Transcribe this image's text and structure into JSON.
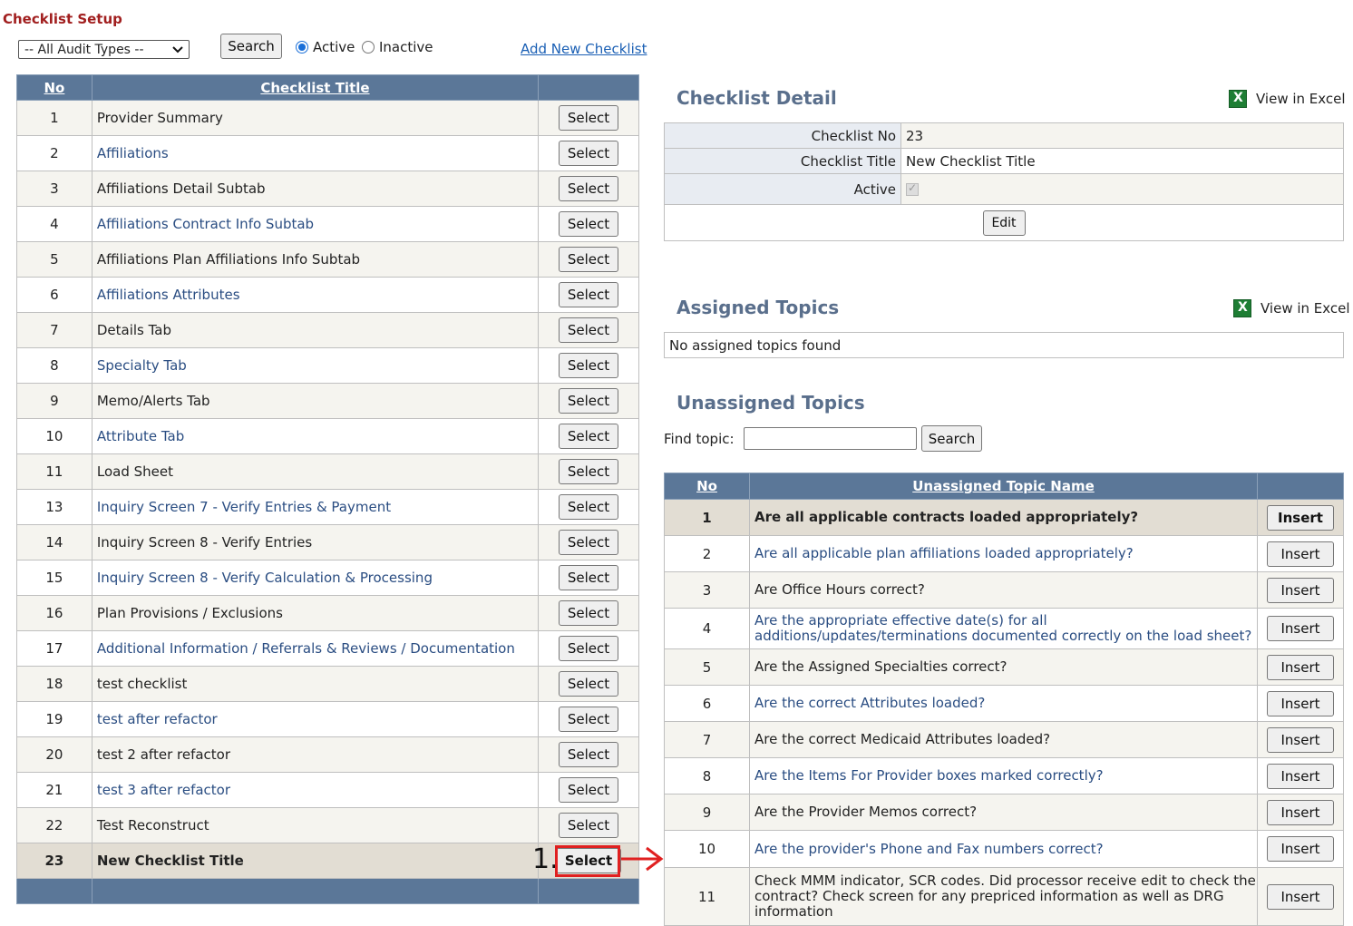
{
  "page": {
    "title": "Checklist Setup"
  },
  "filter": {
    "audit_type": "-- All Audit Types --",
    "search_label": "Search",
    "status_options": [
      {
        "label": "Active",
        "checked": true
      },
      {
        "label": "Inactive",
        "checked": false
      }
    ],
    "add_link": "Add New Checklist"
  },
  "checklist_table": {
    "headers": {
      "no": "No",
      "title": "Checklist Title"
    },
    "select_label": "Select",
    "rows": [
      {
        "no": "1",
        "title": "Provider Summary",
        "link": false
      },
      {
        "no": "2",
        "title": "Affiliations",
        "link": true
      },
      {
        "no": "3",
        "title": "Affiliations Detail Subtab",
        "link": false
      },
      {
        "no": "4",
        "title": "Affiliations Contract Info Subtab",
        "link": true
      },
      {
        "no": "5",
        "title": "Affiliations Plan Affiliations Info Subtab",
        "link": false
      },
      {
        "no": "6",
        "title": "Affiliations Attributes",
        "link": true
      },
      {
        "no": "7",
        "title": "Details Tab",
        "link": false
      },
      {
        "no": "8",
        "title": "Specialty Tab",
        "link": true
      },
      {
        "no": "9",
        "title": "Memo/Alerts Tab",
        "link": false
      },
      {
        "no": "10",
        "title": "Attribute Tab",
        "link": true
      },
      {
        "no": "11",
        "title": "Load Sheet",
        "link": false
      },
      {
        "no": "13",
        "title": "Inquiry Screen 7 - Verify Entries & Payment",
        "link": true
      },
      {
        "no": "14",
        "title": "Inquiry Screen 8 - Verify Entries",
        "link": false
      },
      {
        "no": "15",
        "title": "Inquiry Screen 8 - Verify Calculation & Processing",
        "link": true
      },
      {
        "no": "16",
        "title": "Plan Provisions / Exclusions",
        "link": false
      },
      {
        "no": "17",
        "title": "Additional Information / Referrals & Reviews / Documentation",
        "link": true
      },
      {
        "no": "18",
        "title": "test checklist",
        "link": false
      },
      {
        "no": "19",
        "title": "test after refactor",
        "link": true
      },
      {
        "no": "20",
        "title": "test 2 after refactor",
        "link": false
      },
      {
        "no": "21",
        "title": "test 3 after refactor",
        "link": true
      },
      {
        "no": "22",
        "title": "Test Reconstruct",
        "link": false
      },
      {
        "no": "23",
        "title": "New Checklist Title",
        "link": false,
        "selected": true
      }
    ]
  },
  "checklist_detail": {
    "title": "Checklist Detail",
    "excel_label": "View in Excel",
    "no_label": "Checklist No",
    "no_value": "23",
    "title_label": "Checklist Title",
    "title_value": "New Checklist Title",
    "active_label": "Active",
    "active_checked": true,
    "edit_label": "Edit"
  },
  "assigned_topics": {
    "title": "Assigned Topics",
    "excel_label": "View in Excel",
    "empty_text": "No assigned topics found"
  },
  "unassigned_topics": {
    "title": "Unassigned Topics",
    "find_label": "Find topic:",
    "find_value": "",
    "search_label": "Search",
    "headers": {
      "no": "No",
      "name": "Unassigned Topic Name"
    },
    "insert_label": "Insert",
    "rows": [
      {
        "no": "1",
        "name": "Are all applicable contracts loaded appropriately?",
        "link": false,
        "highlight": true
      },
      {
        "no": "2",
        "name": "Are all applicable plan affiliations loaded appropriately?",
        "link": true
      },
      {
        "no": "3",
        "name": "Are Office Hours correct?",
        "link": false
      },
      {
        "no": "4",
        "name": "Are the appropriate effective date(s) for all additions/updates/terminations documented correctly on the load sheet?",
        "link": true
      },
      {
        "no": "5",
        "name": "Are the Assigned Specialties correct?",
        "link": false
      },
      {
        "no": "6",
        "name": "Are the correct Attributes loaded?",
        "link": true
      },
      {
        "no": "7",
        "name": "Are the correct Medicaid Attributes loaded?",
        "link": false
      },
      {
        "no": "8",
        "name": "Are the Items For Provider boxes marked correctly?",
        "link": true
      },
      {
        "no": "9",
        "name": "Are the Provider Memos correct?",
        "link": false
      },
      {
        "no": "10",
        "name": "Are the provider's Phone and Fax numbers correct?",
        "link": true
      },
      {
        "no": "11",
        "name": "Check MMM indicator, SCR codes. Did processor receive edit to check the contract? Check screen for any prepriced information as well as DRG information",
        "link": false
      }
    ]
  },
  "annotation": {
    "callout": "1.",
    "color": "#e02020"
  }
}
